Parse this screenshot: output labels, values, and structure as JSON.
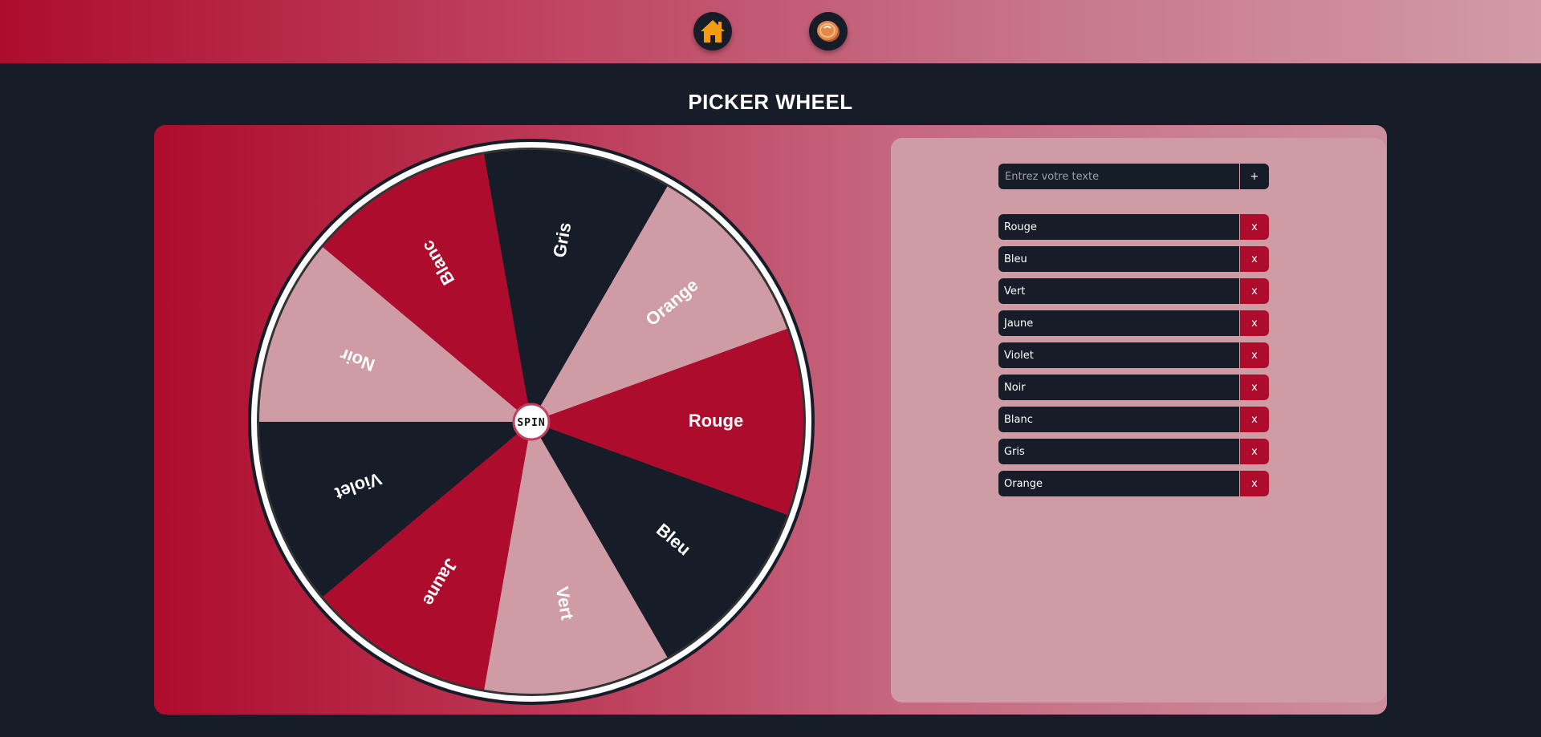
{
  "colors": {
    "accent": "#ae0c2d",
    "dark": "#171d28",
    "light": "#cf9ca6",
    "white": "#ffffff"
  },
  "nav": {
    "home_icon": "home-icon",
    "coin_icon": "coin-icon"
  },
  "title": "PICKER WHEEL",
  "wheel": {
    "spin_label": "SPIN",
    "segments": [
      {
        "label": "Rouge",
        "color": "#ae0c2d"
      },
      {
        "label": "Bleu",
        "color": "#171d28"
      },
      {
        "label": "Vert",
        "color": "#cf9ca6"
      },
      {
        "label": "Jaune",
        "color": "#ae0c2d"
      },
      {
        "label": "Violet",
        "color": "#171d28"
      },
      {
        "label": "Noir",
        "color": "#cf9ca6"
      },
      {
        "label": "Blanc",
        "color": "#ae0c2d"
      },
      {
        "label": "Gris",
        "color": "#171d28"
      },
      {
        "label": "Orange",
        "color": "#cf9ca6"
      }
    ]
  },
  "editor": {
    "input_placeholder": "Entrez votre texte",
    "add_label": "+",
    "remove_label": "x",
    "items": [
      "Rouge",
      "Bleu",
      "Vert",
      "Jaune",
      "Violet",
      "Noir",
      "Blanc",
      "Gris",
      "Orange"
    ]
  }
}
